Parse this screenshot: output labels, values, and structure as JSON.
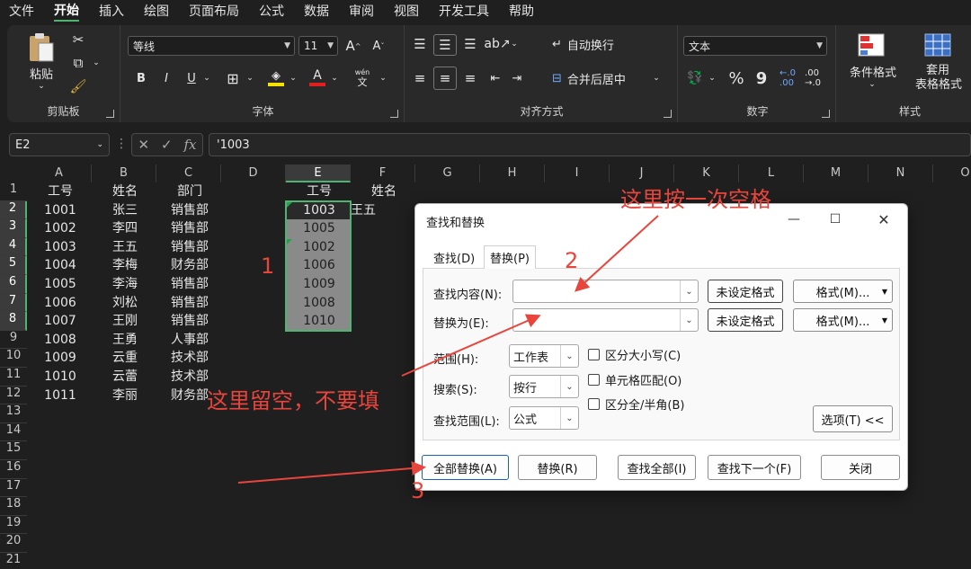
{
  "menu": [
    "文件",
    "开始",
    "插入",
    "绘图",
    "页面布局",
    "公式",
    "数据",
    "审阅",
    "视图",
    "开发工具",
    "帮助"
  ],
  "menu_active_index": 1,
  "ribbon": {
    "clipboard": {
      "paste_label": "粘贴",
      "group_label": "剪贴板"
    },
    "font": {
      "font_name": "等线",
      "font_size": "11",
      "bold": "B",
      "italic": "I",
      "underline": "U",
      "pinyin": "wén",
      "pinyin_char": "文",
      "group_label": "字体"
    },
    "align": {
      "wrap_label": "自动换行",
      "merge_label": "合并后居中",
      "group_label": "对齐方式"
    },
    "number": {
      "format": "文本",
      "percent": "%",
      "comma": "9",
      "group_label": "数字"
    },
    "styles": {
      "conditional": "条件格式",
      "table_format_1": "套用",
      "table_format_2": "表格格式",
      "group_label": "样式"
    }
  },
  "formula_bar": {
    "name_box": "E2",
    "formula": "'1003",
    "fx": "fx"
  },
  "columns": [
    "A",
    "B",
    "C",
    "D",
    "E",
    "F",
    "G",
    "H",
    "I",
    "J",
    "K",
    "L",
    "M",
    "N",
    "O"
  ],
  "selected_column": "E",
  "rows": [
    "1",
    "2",
    "3",
    "4",
    "5",
    "6",
    "7",
    "8",
    "9",
    "10",
    "11",
    "12",
    "13",
    "14",
    "15",
    "16",
    "17",
    "18",
    "19",
    "20",
    "21"
  ],
  "sheet": {
    "A": [
      "工号",
      "1001",
      "1002",
      "1003",
      "1004",
      "1005",
      "1006",
      "1007",
      "1008",
      "1009",
      "1010",
      "1011"
    ],
    "B": [
      "姓名",
      "张三",
      "李四",
      "王五",
      "李梅",
      "李海",
      "刘松",
      "王刚",
      "王勇",
      "云重",
      "云蕾",
      "李丽"
    ],
    "C": [
      "部门",
      "销售部",
      "销售部",
      "销售部",
      "财务部",
      "销售部",
      "销售部",
      "销售部",
      "人事部",
      "技术部",
      "技术部",
      "财务部"
    ],
    "E": [
      "工号",
      "1003",
      "1005",
      "1002",
      "1006",
      "1009",
      "1008",
      "1010"
    ],
    "F": [
      "姓名",
      "王五"
    ]
  },
  "dialog": {
    "title": "查找和替换",
    "tabs": [
      "查找(D)",
      "替换(P)"
    ],
    "find_label": "查找内容(N):",
    "find_value": "",
    "replace_label": "替换为(E):",
    "replace_value": "",
    "no_format": "未设定格式",
    "format_btn": "格式(M)...",
    "scope_label": "范围(H):",
    "scope_value": "工作表",
    "search_label": "搜索(S):",
    "search_value": "按行",
    "lookin_label": "查找范围(L):",
    "lookin_value": "公式",
    "match_case": "区分大小写(C)",
    "match_cell": "单元格匹配(O)",
    "match_width": "区分全/半角(B)",
    "options_btn": "选项(T) <<",
    "replace_all": "全部替换(A)",
    "replace": "替换(R)",
    "find_all": "查找全部(I)",
    "find_next": "查找下一个(F)",
    "close": "关闭"
  },
  "annotations": {
    "note_space": "这里按一次空格",
    "note_empty": "这里留空，不要填",
    "num1": "1",
    "num2": "2",
    "num3": "3",
    "color": "#e8453c"
  },
  "colors": {
    "accent": "#4fb371",
    "selection": "#8a8a8a"
  }
}
